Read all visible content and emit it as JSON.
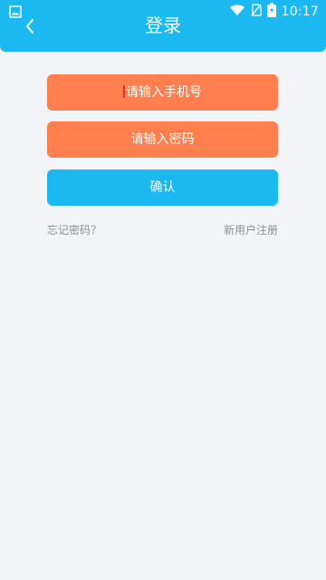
{
  "status": {
    "time": "10:17",
    "icons": [
      "image-icon",
      "wifi-icon",
      "no-sim-icon",
      "battery-charging-icon"
    ]
  },
  "header": {
    "title": "登录",
    "back_icon": "back-arrow-icon"
  },
  "form": {
    "phone_placeholder": "请输入手机号",
    "password_placeholder": "请输入密码",
    "confirm_label": "确认"
  },
  "links": {
    "forgot": "忘记密码？",
    "register": "新用户注册"
  },
  "colors": {
    "primary": "#1bb8f2",
    "input_bg": "#ff7f4f",
    "page_bg": "#f2f4f7",
    "link": "#8b8f96"
  }
}
